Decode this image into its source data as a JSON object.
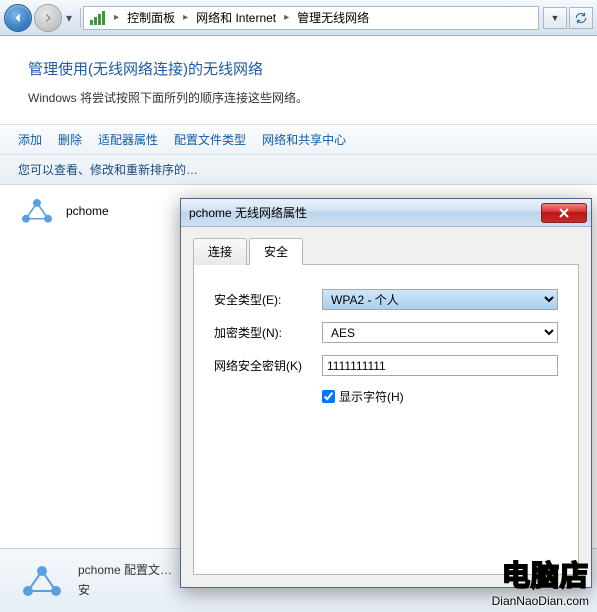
{
  "breadcrumb": {
    "items": [
      "控制面板",
      "网络和 Internet",
      "管理无线网络"
    ]
  },
  "main": {
    "heading": "管理使用(无线网络连接)的无线网络",
    "subtext": "Windows 将尝试按照下面所列的顺序连接这些网络。"
  },
  "toolbar": {
    "add": "添加",
    "remove": "删除",
    "adapter": "适配器属性",
    "profile_type": "配置文件类型",
    "sharing_center": "网络和共享中心"
  },
  "instruction": "您可以查看、修改和重新排序的…",
  "networks": {
    "items": [
      {
        "name": "pchome"
      }
    ]
  },
  "details": {
    "name": "pchome",
    "line1_suffix": " 配置文…",
    "line2_prefix": "安"
  },
  "dialog": {
    "title": "pchome 无线网络属性",
    "tabs": {
      "connect": "连接",
      "security": "安全"
    },
    "form": {
      "security_type_label": "安全类型(E):",
      "security_type_value": "WPA2 - 个人",
      "encryption_label": "加密类型(N):",
      "encryption_value": "AES",
      "key_label": "网络安全密钥(K)",
      "key_value": "1111111111",
      "show_chars": "显示字符(H)"
    }
  },
  "watermark": {
    "big": "电脑店",
    "small": "DianNaoDian.com"
  }
}
